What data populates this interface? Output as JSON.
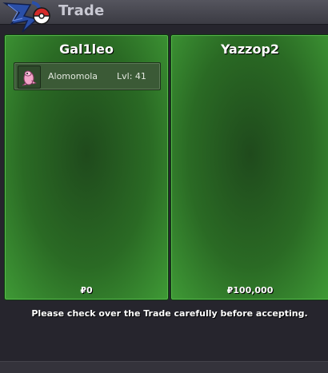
{
  "window": {
    "title": "Trade"
  },
  "left_panel": {
    "player_name": "Gal1leo",
    "currency": "₽0",
    "pokemon": [
      {
        "name": "Alomomola",
        "level": "Lvl: 41"
      }
    ]
  },
  "right_panel": {
    "player_name": "Yazzop2",
    "currency": "₽100,000"
  },
  "notice": "Please check over the Trade carefully before accepting.",
  "colors": {
    "panel_green": "#2a6a24",
    "panel_border_light": "#55b84a",
    "background": "#26252d",
    "titlebar": "#4a4a52"
  }
}
